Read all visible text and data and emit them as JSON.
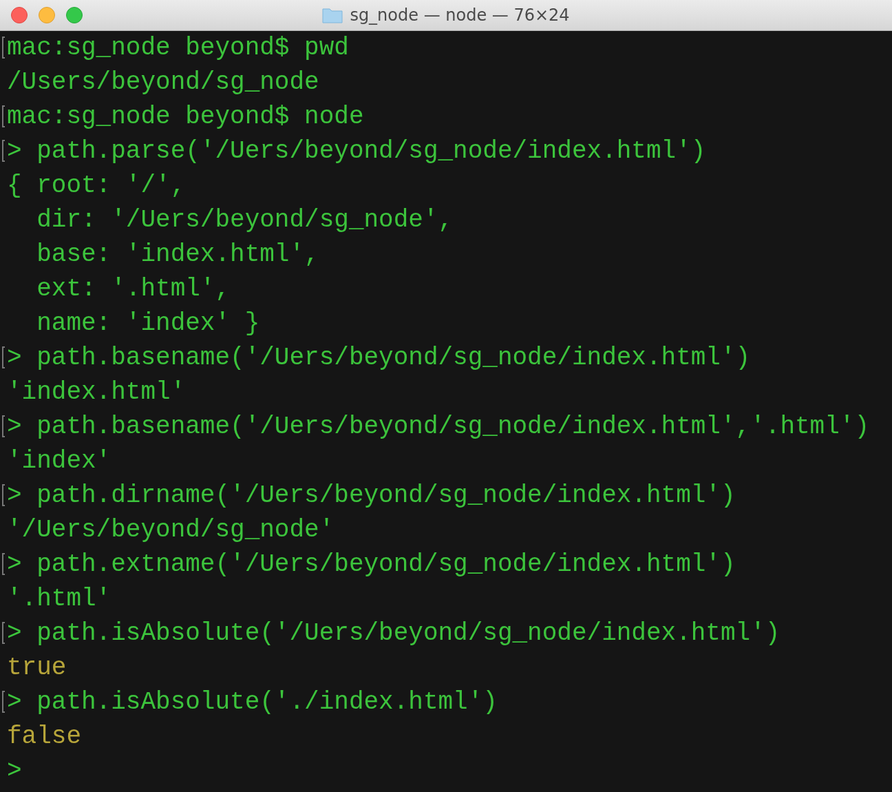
{
  "window": {
    "title": "sg_node — node — 76×24"
  },
  "lines": [
    {
      "text": "mac:sg_node beyond$ pwd",
      "kind": "input",
      "marked": true
    },
    {
      "text": "/Users/beyond/sg_node",
      "kind": "output",
      "marked": false
    },
    {
      "text": "mac:sg_node beyond$ node",
      "kind": "input",
      "marked": true
    },
    {
      "text": "> path.parse('/Uers/beyond/sg_node/index.html')",
      "kind": "input",
      "marked": true
    },
    {
      "text": "{ root: '/',",
      "kind": "output",
      "marked": false
    },
    {
      "text": "  dir: '/Uers/beyond/sg_node',",
      "kind": "output",
      "marked": false
    },
    {
      "text": "  base: 'index.html',",
      "kind": "output",
      "marked": false
    },
    {
      "text": "  ext: '.html',",
      "kind": "output",
      "marked": false
    },
    {
      "text": "  name: 'index' }",
      "kind": "output",
      "marked": false
    },
    {
      "text": "> path.basename('/Uers/beyond/sg_node/index.html')",
      "kind": "input",
      "marked": true
    },
    {
      "text": "'index.html'",
      "kind": "output",
      "marked": false
    },
    {
      "text": "> path.basename('/Uers/beyond/sg_node/index.html','.html')",
      "kind": "input",
      "marked": true
    },
    {
      "text": "'index'",
      "kind": "output",
      "marked": false
    },
    {
      "text": "> path.dirname('/Uers/beyond/sg_node/index.html')",
      "kind": "input",
      "marked": true
    },
    {
      "text": "'/Uers/beyond/sg_node'",
      "kind": "output",
      "marked": false
    },
    {
      "text": "> path.extname('/Uers/beyond/sg_node/index.html')",
      "kind": "input",
      "marked": true
    },
    {
      "text": "'.html'",
      "kind": "output",
      "marked": false
    },
    {
      "text": "> path.isAbsolute('/Uers/beyond/sg_node/index.html')",
      "kind": "input",
      "marked": true
    },
    {
      "text": "true",
      "kind": "boolean",
      "marked": false
    },
    {
      "text": "> path.isAbsolute('./index.html')",
      "kind": "input",
      "marked": true
    },
    {
      "text": "false",
      "kind": "boolean",
      "marked": false
    },
    {
      "text": ">",
      "kind": "input",
      "marked": false
    }
  ]
}
